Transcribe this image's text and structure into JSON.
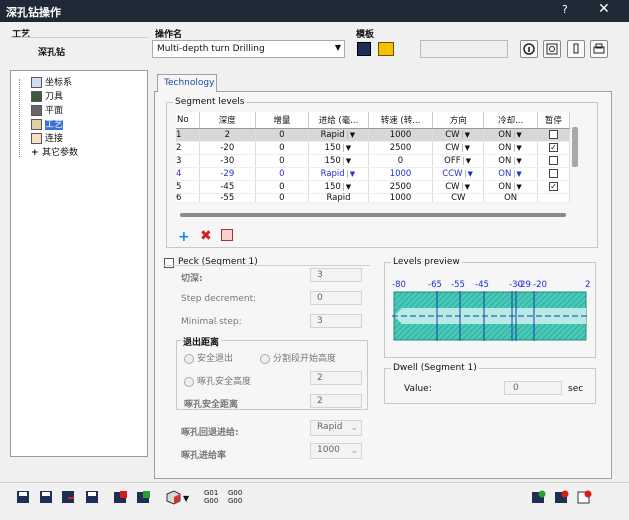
{
  "window": {
    "title": "深孔钻操作",
    "help": "?",
    "close": "✕"
  },
  "header": {
    "process_label": "工艺",
    "process_value": "深孔钻",
    "opname_label": "操作名",
    "opname_value": "Multi-depth turn Drilling",
    "template_label": "模板"
  },
  "tree": {
    "items": [
      {
        "label": "坐标系"
      },
      {
        "label": "刀具"
      },
      {
        "label": "平面"
      },
      {
        "label": "工艺"
      },
      {
        "label": "连接"
      },
      {
        "label": "其它参数"
      }
    ]
  },
  "tabs": [
    {
      "label": "Technology"
    }
  ],
  "segment_levels": {
    "title": "Segment levels",
    "columns": [
      "No",
      "深度",
      "增量",
      "进给 (毫...",
      "转速 (转...",
      "方向",
      "冷却...",
      "暂停"
    ],
    "rows": [
      {
        "no": "1",
        "depth": "2",
        "inc": "0",
        "feed": "Rapid",
        "speed": "1000",
        "dir": "CW",
        "cool": "ON",
        "pause": ""
      },
      {
        "no": "2",
        "depth": "-20",
        "inc": "0",
        "feed": "150",
        "speed": "2500",
        "dir": "CW",
        "cool": "ON",
        "pause": "✓"
      },
      {
        "no": "3",
        "depth": "-30",
        "inc": "0",
        "feed": "150",
        "speed": "0",
        "dir": "OFF",
        "cool": "ON",
        "pause": ""
      },
      {
        "no": "4",
        "depth": "-29",
        "inc": "0",
        "feed": "Rapid",
        "speed": "1000",
        "dir": "CCW",
        "cool": "ON",
        "pause": ""
      },
      {
        "no": "5",
        "depth": "-45",
        "inc": "0",
        "feed": "150",
        "speed": "2500",
        "dir": "CW",
        "cool": "ON",
        "pause": "✓"
      },
      {
        "no": "6",
        "depth": "-55",
        "inc": "0",
        "feed": "Rapid",
        "speed": "1000",
        "dir": "CW",
        "cool": "ON",
        "pause": ""
      }
    ]
  },
  "peck": {
    "title": "Peck (Segment 1)",
    "cut_depth_label": "切深:",
    "cut_depth": "3",
    "step_dec_label": "Step decrement:",
    "step_dec": "0",
    "min_step_label": "Minimal step:",
    "min_step": "3",
    "retract_title": "退出距离",
    "safe_exit": "安全退出",
    "seg_start": "分割段开始高度",
    "peck_safe_height": "啄孔安全高度",
    "peck_safe_height_val": "2",
    "peck_safe_dist_label": "啄孔安全距离",
    "peck_safe_dist": "2",
    "retract_feed_label": "啄孔回退进给:",
    "retract_feed": "Rapid",
    "feed_rate_label": "啄孔进给率",
    "feed_rate": "1000"
  },
  "preview": {
    "title": "Levels preview",
    "ticks": [
      "-80",
      "-65",
      "-55",
      "-45",
      "-30",
      "-29",
      "-20",
      "2"
    ]
  },
  "dwell": {
    "title": "Dwell (Segment 1)",
    "value_label": "Value:",
    "value": "0",
    "unit": "sec"
  },
  "bottom_toolbar": {
    "g01": "G01",
    "g00": "G00",
    "g01b": "G00",
    "g00b": "G00"
  }
}
